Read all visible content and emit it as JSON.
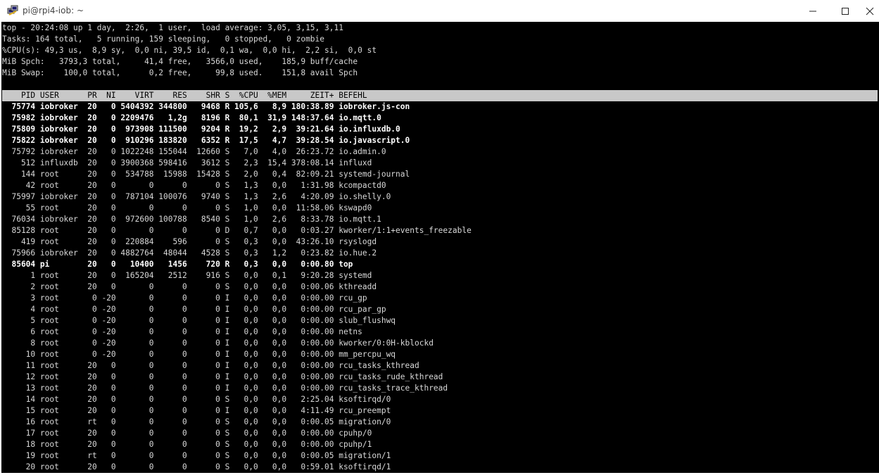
{
  "window": {
    "title": "pi@rpi4-iob: ~"
  },
  "summary": [
    "top - 20:24:08 up 1 day,  2:26,  1 user,  load average: 3,05, 3,15, 3,11",
    "Tasks: 164 total,   5 running, 159 sleeping,   0 stopped,   0 zombie",
    "%CPU(s): 49,3 us,  8,9 sy,  0,0 ni, 39,5 id,  0,1 wa,  0,0 hi,  2,2 si,  0,0 st",
    "MiB Spch:   3793,3 total,     41,4 free,   3566,0 used,    185,9 buff/cache",
    "MiB Swap:    100,0 total,      0,2 free,     99,8 used.    151,8 avail Spch"
  ],
  "columns": [
    "PID",
    "USER",
    "PR",
    "NI",
    "VIRT",
    "RES",
    "SHR",
    "S",
    "%CPU",
    "%MEM",
    "ZEIT+",
    "BEFEHL"
  ],
  "processes": [
    {
      "pid": "75774",
      "user": "iobroker",
      "pr": "20",
      "ni": "0",
      "virt": "5404392",
      "res": "344800",
      "shr": "9468",
      "s": "R",
      "cpu": "105,6",
      "mem": "8,9",
      "time": "180:38.89",
      "cmd": "iobroker.js-con",
      "running": true
    },
    {
      "pid": "75982",
      "user": "iobroker",
      "pr": "20",
      "ni": "0",
      "virt": "2209476",
      "res": "1,2g",
      "shr": "8196",
      "s": "R",
      "cpu": "80,1",
      "mem": "31,9",
      "time": "148:37.64",
      "cmd": "io.mqtt.0",
      "running": true
    },
    {
      "pid": "75809",
      "user": "iobroker",
      "pr": "20",
      "ni": "0",
      "virt": "973908",
      "res": "111500",
      "shr": "9204",
      "s": "R",
      "cpu": "19,2",
      "mem": "2,9",
      "time": "39:21.64",
      "cmd": "io.influxdb.0",
      "running": true
    },
    {
      "pid": "75822",
      "user": "iobroker",
      "pr": "20",
      "ni": "0",
      "virt": "910296",
      "res": "183820",
      "shr": "6352",
      "s": "R",
      "cpu": "17,5",
      "mem": "4,7",
      "time": "39:28.54",
      "cmd": "io.javascript.0",
      "running": true
    },
    {
      "pid": "75792",
      "user": "iobroker",
      "pr": "20",
      "ni": "0",
      "virt": "1022248",
      "res": "155044",
      "shr": "12660",
      "s": "S",
      "cpu": "7,0",
      "mem": "4,0",
      "time": "26:23.72",
      "cmd": "io.admin.0",
      "running": false
    },
    {
      "pid": "512",
      "user": "influxdb",
      "pr": "20",
      "ni": "0",
      "virt": "3900368",
      "res": "598416",
      "shr": "3612",
      "s": "S",
      "cpu": "2,3",
      "mem": "15,4",
      "time": "378:08.14",
      "cmd": "influxd",
      "running": false
    },
    {
      "pid": "144",
      "user": "root",
      "pr": "20",
      "ni": "0",
      "virt": "534788",
      "res": "15988",
      "shr": "15428",
      "s": "S",
      "cpu": "2,0",
      "mem": "0,4",
      "time": "82:09.21",
      "cmd": "systemd-journal",
      "running": false
    },
    {
      "pid": "42",
      "user": "root",
      "pr": "20",
      "ni": "0",
      "virt": "0",
      "res": "0",
      "shr": "0",
      "s": "S",
      "cpu": "1,3",
      "mem": "0,0",
      "time": "1:31.98",
      "cmd": "kcompactd0",
      "running": false
    },
    {
      "pid": "75997",
      "user": "iobroker",
      "pr": "20",
      "ni": "0",
      "virt": "787104",
      "res": "100076",
      "shr": "9740",
      "s": "S",
      "cpu": "1,3",
      "mem": "2,6",
      "time": "4:20.09",
      "cmd": "io.shelly.0",
      "running": false
    },
    {
      "pid": "55",
      "user": "root",
      "pr": "20",
      "ni": "0",
      "virt": "0",
      "res": "0",
      "shr": "0",
      "s": "S",
      "cpu": "1,0",
      "mem": "0,0",
      "time": "11:58.06",
      "cmd": "kswapd0",
      "running": false
    },
    {
      "pid": "76034",
      "user": "iobroker",
      "pr": "20",
      "ni": "0",
      "virt": "972600",
      "res": "100788",
      "shr": "8540",
      "s": "S",
      "cpu": "1,0",
      "mem": "2,6",
      "time": "8:33.78",
      "cmd": "io.mqtt.1",
      "running": false
    },
    {
      "pid": "85128",
      "user": "root",
      "pr": "20",
      "ni": "0",
      "virt": "0",
      "res": "0",
      "shr": "0",
      "s": "D",
      "cpu": "0,7",
      "mem": "0,0",
      "time": "0:03.27",
      "cmd": "kworker/1:1+events_freezable",
      "running": false
    },
    {
      "pid": "419",
      "user": "root",
      "pr": "20",
      "ni": "0",
      "virt": "220884",
      "res": "596",
      "shr": "0",
      "s": "S",
      "cpu": "0,3",
      "mem": "0,0",
      "time": "43:26.10",
      "cmd": "rsyslogd",
      "running": false
    },
    {
      "pid": "75966",
      "user": "iobroker",
      "pr": "20",
      "ni": "0",
      "virt": "4882764",
      "res": "48044",
      "shr": "4528",
      "s": "S",
      "cpu": "0,3",
      "mem": "1,2",
      "time": "0:23.82",
      "cmd": "io.hue.2",
      "running": false
    },
    {
      "pid": "85604",
      "user": "pi",
      "pr": "20",
      "ni": "0",
      "virt": "10400",
      "res": "1456",
      "shr": "720",
      "s": "R",
      "cpu": "0,3",
      "mem": "0,0",
      "time": "0:00.80",
      "cmd": "top",
      "running": true
    },
    {
      "pid": "1",
      "user": "root",
      "pr": "20",
      "ni": "0",
      "virt": "165204",
      "res": "2512",
      "shr": "916",
      "s": "S",
      "cpu": "0,0",
      "mem": "0,1",
      "time": "9:20.28",
      "cmd": "systemd",
      "running": false
    },
    {
      "pid": "2",
      "user": "root",
      "pr": "20",
      "ni": "0",
      "virt": "0",
      "res": "0",
      "shr": "0",
      "s": "S",
      "cpu": "0,0",
      "mem": "0,0",
      "time": "0:00.06",
      "cmd": "kthreadd",
      "running": false
    },
    {
      "pid": "3",
      "user": "root",
      "pr": "0",
      "ni": "-20",
      "virt": "0",
      "res": "0",
      "shr": "0",
      "s": "I",
      "cpu": "0,0",
      "mem": "0,0",
      "time": "0:00.00",
      "cmd": "rcu_gp",
      "running": false
    },
    {
      "pid": "4",
      "user": "root",
      "pr": "0",
      "ni": "-20",
      "virt": "0",
      "res": "0",
      "shr": "0",
      "s": "I",
      "cpu": "0,0",
      "mem": "0,0",
      "time": "0:00.00",
      "cmd": "rcu_par_gp",
      "running": false
    },
    {
      "pid": "5",
      "user": "root",
      "pr": "0",
      "ni": "-20",
      "virt": "0",
      "res": "0",
      "shr": "0",
      "s": "I",
      "cpu": "0,0",
      "mem": "0,0",
      "time": "0:00.00",
      "cmd": "slub_flushwq",
      "running": false
    },
    {
      "pid": "6",
      "user": "root",
      "pr": "0",
      "ni": "-20",
      "virt": "0",
      "res": "0",
      "shr": "0",
      "s": "I",
      "cpu": "0,0",
      "mem": "0,0",
      "time": "0:00.00",
      "cmd": "netns",
      "running": false
    },
    {
      "pid": "8",
      "user": "root",
      "pr": "0",
      "ni": "-20",
      "virt": "0",
      "res": "0",
      "shr": "0",
      "s": "I",
      "cpu": "0,0",
      "mem": "0,0",
      "time": "0:00.00",
      "cmd": "kworker/0:0H-kblockd",
      "running": false
    },
    {
      "pid": "10",
      "user": "root",
      "pr": "0",
      "ni": "-20",
      "virt": "0",
      "res": "0",
      "shr": "0",
      "s": "I",
      "cpu": "0,0",
      "mem": "0,0",
      "time": "0:00.00",
      "cmd": "mm_percpu_wq",
      "running": false
    },
    {
      "pid": "11",
      "user": "root",
      "pr": "20",
      "ni": "0",
      "virt": "0",
      "res": "0",
      "shr": "0",
      "s": "I",
      "cpu": "0,0",
      "mem": "0,0",
      "time": "0:00.00",
      "cmd": "rcu_tasks_kthread",
      "running": false
    },
    {
      "pid": "12",
      "user": "root",
      "pr": "20",
      "ni": "0",
      "virt": "0",
      "res": "0",
      "shr": "0",
      "s": "I",
      "cpu": "0,0",
      "mem": "0,0",
      "time": "0:00.00",
      "cmd": "rcu_tasks_rude_kthread",
      "running": false
    },
    {
      "pid": "13",
      "user": "root",
      "pr": "20",
      "ni": "0",
      "virt": "0",
      "res": "0",
      "shr": "0",
      "s": "I",
      "cpu": "0,0",
      "mem": "0,0",
      "time": "0:00.00",
      "cmd": "rcu_tasks_trace_kthread",
      "running": false
    },
    {
      "pid": "14",
      "user": "root",
      "pr": "20",
      "ni": "0",
      "virt": "0",
      "res": "0",
      "shr": "0",
      "s": "S",
      "cpu": "0,0",
      "mem": "0,0",
      "time": "2:25.04",
      "cmd": "ksoftirqd/0",
      "running": false
    },
    {
      "pid": "15",
      "user": "root",
      "pr": "20",
      "ni": "0",
      "virt": "0",
      "res": "0",
      "shr": "0",
      "s": "I",
      "cpu": "0,0",
      "mem": "0,0",
      "time": "4:11.49",
      "cmd": "rcu_preempt",
      "running": false
    },
    {
      "pid": "16",
      "user": "root",
      "pr": "rt",
      "ni": "0",
      "virt": "0",
      "res": "0",
      "shr": "0",
      "s": "S",
      "cpu": "0,0",
      "mem": "0,0",
      "time": "0:00.05",
      "cmd": "migration/0",
      "running": false
    },
    {
      "pid": "17",
      "user": "root",
      "pr": "20",
      "ni": "0",
      "virt": "0",
      "res": "0",
      "shr": "0",
      "s": "S",
      "cpu": "0,0",
      "mem": "0,0",
      "time": "0:00.00",
      "cmd": "cpuhp/0",
      "running": false
    },
    {
      "pid": "18",
      "user": "root",
      "pr": "20",
      "ni": "0",
      "virt": "0",
      "res": "0",
      "shr": "0",
      "s": "S",
      "cpu": "0,0",
      "mem": "0,0",
      "time": "0:00.00",
      "cmd": "cpuhp/1",
      "running": false
    },
    {
      "pid": "19",
      "user": "root",
      "pr": "rt",
      "ni": "0",
      "virt": "0",
      "res": "0",
      "shr": "0",
      "s": "S",
      "cpu": "0,0",
      "mem": "0,0",
      "time": "0:00.05",
      "cmd": "migration/1",
      "running": false
    },
    {
      "pid": "20",
      "user": "root",
      "pr": "20",
      "ni": "0",
      "virt": "0",
      "res": "0",
      "shr": "0",
      "s": "S",
      "cpu": "0,0",
      "mem": "0,0",
      "time": "0:59.01",
      "cmd": "ksoftirqd/1",
      "running": false
    }
  ]
}
